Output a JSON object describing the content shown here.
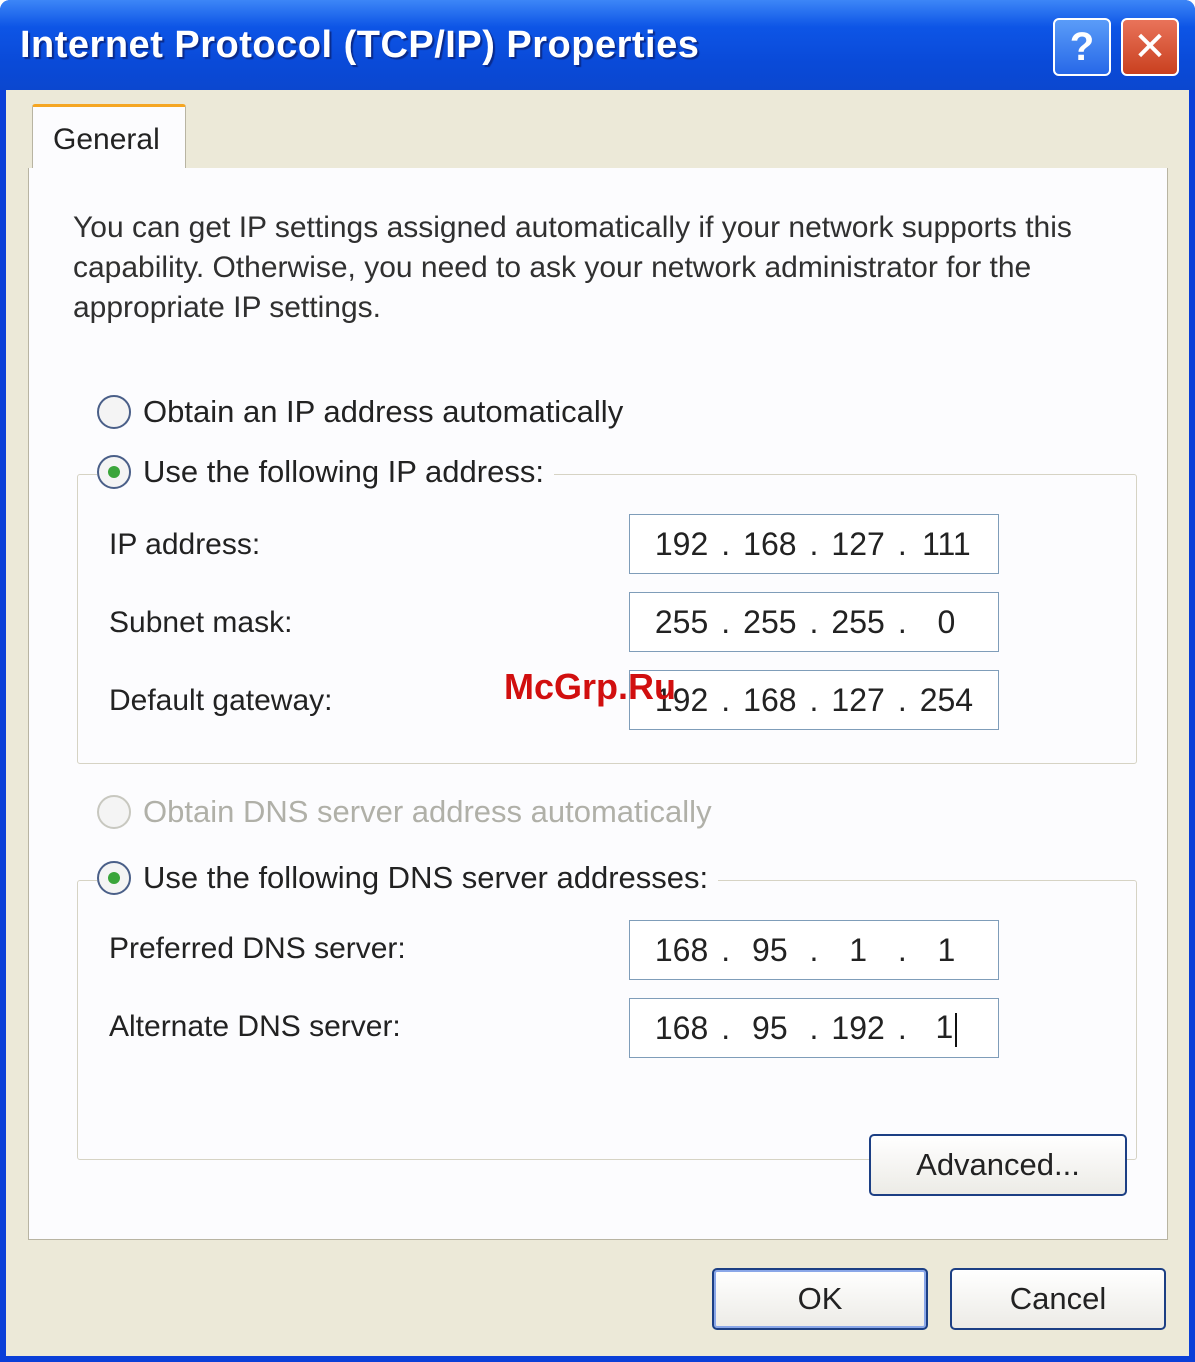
{
  "window": {
    "title": "Internet Protocol (TCP/IP) Properties",
    "help_label": "?",
    "close_label": "✕"
  },
  "tabs": [
    {
      "label": "General",
      "active": true
    }
  ],
  "description": "You can get IP settings assigned automatically if your network supports this capability. Otherwise, you need to ask your network administrator for the appropriate IP settings.",
  "ip_mode": {
    "auto_label": "Obtain an IP address automatically",
    "manual_label": "Use the following IP address:",
    "selected": "manual"
  },
  "ip_fields": [
    {
      "label": "IP address:",
      "octets": [
        "192",
        "168",
        "127",
        "111"
      ]
    },
    {
      "label": "Subnet mask:",
      "octets": [
        "255",
        "255",
        "255",
        "0"
      ]
    },
    {
      "label": "Default gateway:",
      "octets": [
        "192",
        "168",
        "127",
        "254"
      ]
    }
  ],
  "dns_mode": {
    "auto_label": "Obtain DNS server address automatically",
    "manual_label": "Use the following DNS server addresses:",
    "selected": "manual",
    "auto_disabled": true
  },
  "dns_fields": [
    {
      "label": "Preferred DNS server:",
      "octets": [
        "168",
        "95",
        "1",
        "1"
      ]
    },
    {
      "label": "Alternate DNS server:",
      "octets": [
        "168",
        "95",
        "192",
        "1"
      ]
    }
  ],
  "buttons": {
    "advanced": "Advanced...",
    "ok": "OK",
    "cancel": "Cancel"
  },
  "watermark": "McGrp.Ru",
  "colors": {
    "titlebar": "#0a4ad8",
    "dialog_bg": "#ece9d8",
    "tab_accent": "#f5a623",
    "radio_dot": "#3aa53a",
    "watermark": "#d10f0f"
  }
}
